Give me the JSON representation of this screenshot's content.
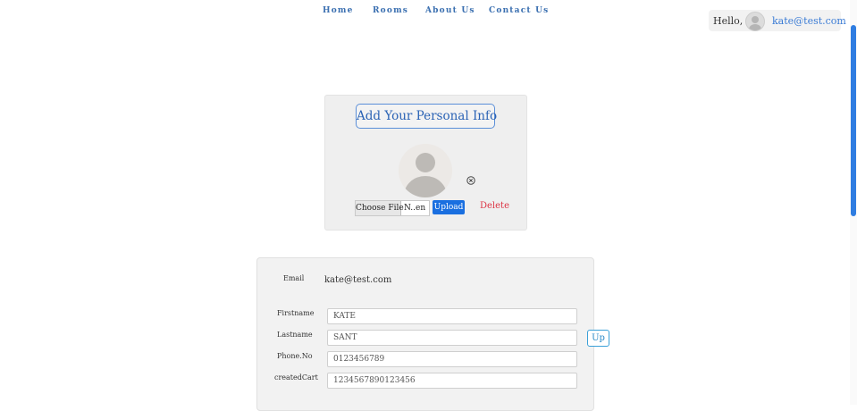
{
  "nav": {
    "home": "Home",
    "rooms": "Rooms",
    "about": "About Us",
    "contact": "Contact Us"
  },
  "user": {
    "greeting": "Hello,",
    "email": "kate@test.com",
    "avatar_icon": "user-avatar-icon"
  },
  "photo": {
    "title": "Add Your Personal Info",
    "avatar_icon": "default-person-icon",
    "remove_icon": "circle-x-icon",
    "choose_file": "Choose File",
    "file_name": "N..en",
    "upload": "Upload",
    "delete": "Delete"
  },
  "details": {
    "email_label": "Email",
    "email_value": "kate@test.com",
    "firstname_label": "Firstname",
    "firstname_value": "KATE",
    "lastname_label": "Lastname",
    "lastname_value": "SANT",
    "phone_label": "Phone.No",
    "phone_value": "0123456789",
    "cart_label": "createdCart",
    "cart_value": "1234567890123456",
    "update_button": "Up"
  },
  "colors": {
    "accent": "#2f7de1",
    "nav_link": "#3a6fb0",
    "danger": "#dc3545"
  }
}
